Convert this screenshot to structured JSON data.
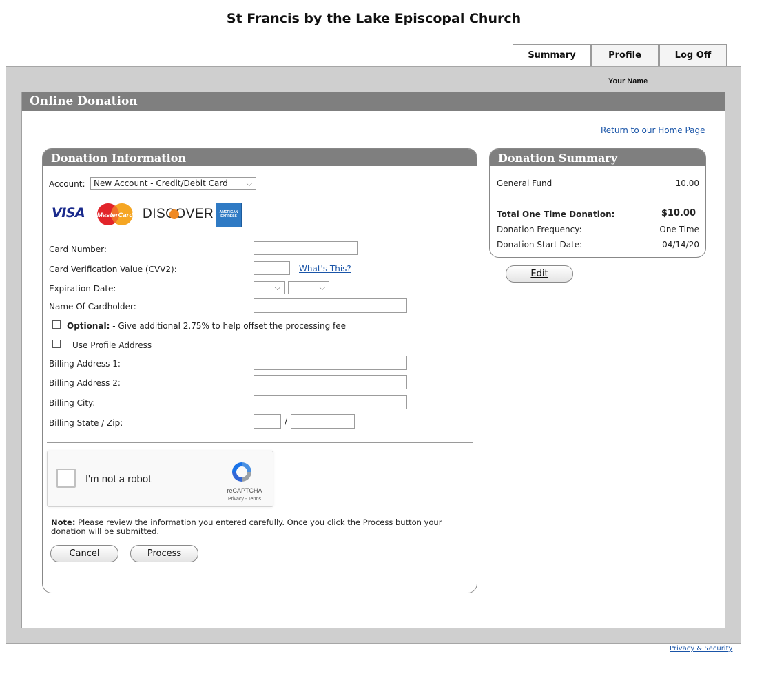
{
  "site": {
    "title": "St Francis by the Lake Episcopal Church"
  },
  "tabs": [
    {
      "label": "Summary",
      "active": true
    },
    {
      "label": "Profile",
      "active": false
    },
    {
      "label": "Log Off",
      "active": false
    }
  ],
  "user": {
    "name": "Your Name"
  },
  "page": {
    "heading": "Online Donation",
    "home_link": "Return to our Home Page"
  },
  "donation_info": {
    "heading": "Donation Information",
    "account_label": "Account:",
    "account_value": "New Account - Credit/Debit Card",
    "card_logos": [
      "VISA",
      "MasterCard",
      "DISCOVER",
      "AMERICAN EXPRESS"
    ],
    "card_number_label": "Card Number:",
    "cvv_label": "Card Verification Value (CVV2):",
    "whats_this": "What's This?",
    "expiration_label": "Expiration Date:",
    "cardholder_label": "Name Of Cardholder:",
    "optional_bold": "Optional:",
    "optional_text": " - Give additional 2.75% to help offset the processing fee",
    "use_profile_address": "Use Profile Address",
    "billing_address1_label": "Billing Address 1:",
    "billing_address2_label": "Billing Address 2:",
    "billing_city_label": "Billing City:",
    "billing_state_zip_label": "Billing State / Zip:",
    "state_zip_separator": "/"
  },
  "captcha": {
    "label": "I'm not a robot",
    "brand": "reCAPTCHA",
    "links": "Privacy - Terms"
  },
  "note": {
    "bold": "Note:",
    "text": " Please review the information you entered carefully. Once you click the Process button your donation will be submitted."
  },
  "buttons": {
    "cancel": "Cancel",
    "process": "Process",
    "edit": "Edit"
  },
  "summary": {
    "heading": "Donation Summary",
    "fund_label": "General Fund",
    "fund_value": "10.00",
    "total_label": "Total One Time Donation:",
    "total_value": "$10.00",
    "frequency_label": "Donation Frequency:",
    "frequency_value": "One Time",
    "start_label": "Donation Start Date:",
    "start_value": "04/14/20"
  },
  "footer": {
    "privacy": "Privacy & Security"
  },
  "colors": {
    "header_gray": "#7f7f7f",
    "frame_gray": "#cfcfcf",
    "link_blue": "#1a55a8"
  },
  "icons": [
    "visa-logo",
    "mastercard-logo",
    "discover-logo",
    "amex-logo",
    "recaptcha-icon",
    "chevron-down-icon"
  ]
}
